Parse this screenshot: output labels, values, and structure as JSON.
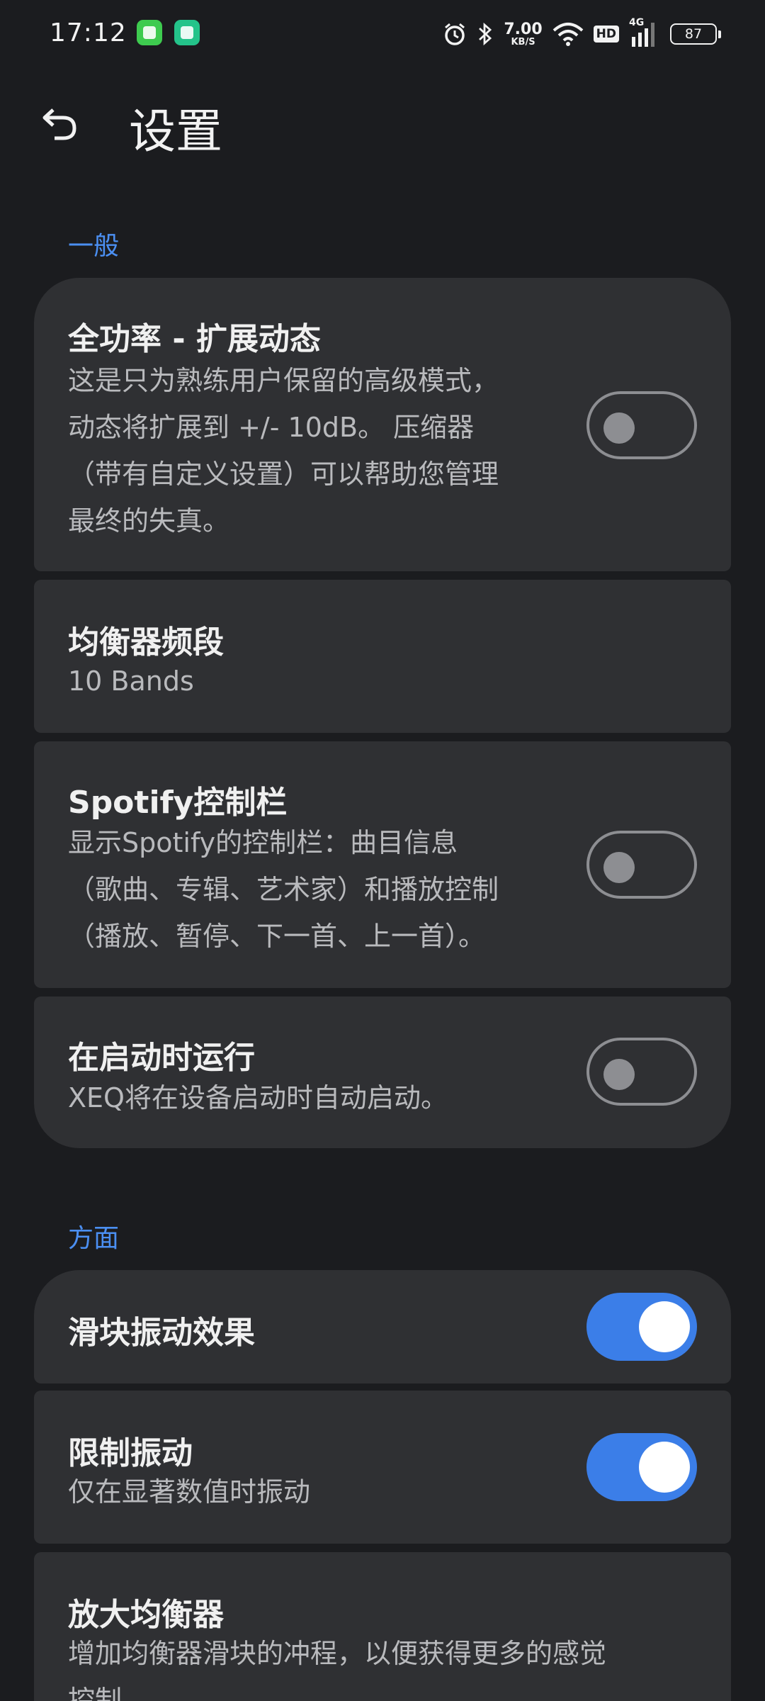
{
  "status_bar": {
    "time": "17:12",
    "net_speed_value": "7.00",
    "net_speed_unit": "KB/S",
    "hd_label": "HD",
    "network_label": "4G",
    "battery": "87",
    "icons": [
      "messages-app-icon",
      "security-app-icon",
      "alarm-icon",
      "bluetooth-icon",
      "wifi-icon",
      "signal-icon",
      "battery-icon"
    ]
  },
  "header": {
    "title": "设置",
    "back_icon": "undo-arrow-icon"
  },
  "sections": {
    "general": {
      "title": "一般",
      "items": [
        {
          "title": "全功率 - 扩展动态",
          "desc": [
            "这是只为熟练用户保留的高级模式，",
            "动态将扩展到 +/- 10dB。 压缩器",
            "（带有自定义设置）可以帮助您管理",
            "最终的失真。"
          ],
          "toggle": "off"
        },
        {
          "title": "均衡器频段",
          "value": "10 Bands"
        },
        {
          "title": "Spotify控制栏",
          "desc": [
            "显示Spotify的控制栏：曲目信息",
            "（歌曲、专辑、艺术家）和播放控制",
            "（播放、暂停、下一首、上一首）。"
          ],
          "toggle": "off"
        },
        {
          "title": "在启动时运行",
          "desc": [
            "XEQ将在设备启动时自动启动。"
          ],
          "toggle": "off"
        }
      ]
    },
    "appearance": {
      "title": "方面",
      "items": [
        {
          "title": "滑块振动效果",
          "toggle": "on"
        },
        {
          "title": "限制振动",
          "desc": [
            "仅在显著数值时振动"
          ],
          "toggle": "on"
        },
        {
          "title": "放大均衡器",
          "desc": [
            "增加均衡器滑块的冲程，以便获得更多的感觉",
            "控制"
          ]
        }
      ]
    }
  },
  "colors": {
    "background": "#1b1c1f",
    "card": "#2f3033",
    "accent": "#3b7ee8",
    "section_title": "#4b8ff2"
  }
}
